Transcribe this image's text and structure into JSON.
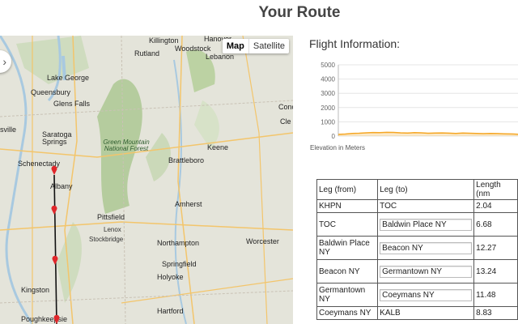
{
  "page": {
    "title": "Your Route"
  },
  "map": {
    "type_controls": {
      "map": "Map",
      "satellite": "Satellite",
      "active": "Map"
    },
    "nav_icon": "chevron-right-icon",
    "cities": [
      {
        "name": "Killington"
      },
      {
        "name": "Hanover"
      },
      {
        "name": "Rutland"
      },
      {
        "name": "Woodstock"
      },
      {
        "name": "Lebanon"
      },
      {
        "name": "Lake George"
      },
      {
        "name": "Queensbury"
      },
      {
        "name": "Glens Falls"
      },
      {
        "name": "Saratoga Springs"
      },
      {
        "name": "Keene"
      },
      {
        "name": "Brattleboro"
      },
      {
        "name": "Schenectady"
      },
      {
        "name": "Albany"
      },
      {
        "name": "Pittsfield"
      },
      {
        "name": "Amherst"
      },
      {
        "name": "Lenox"
      },
      {
        "name": "Stockbridge"
      },
      {
        "name": "Northampton"
      },
      {
        "name": "Worcester"
      },
      {
        "name": "Springfield"
      },
      {
        "name": "Holyoke"
      },
      {
        "name": "Kingston"
      },
      {
        "name": "Hartford"
      },
      {
        "name": "Poughkeepsie"
      },
      {
        "name": "Conc"
      },
      {
        "name": "Cle"
      },
      {
        "name": "sville"
      }
    ],
    "forest_label": "Green Mountain National Forest",
    "route_color": "#111111",
    "marker_color": "#e0272b"
  },
  "flight_info": {
    "heading": "Flight Information:",
    "elevation_label": "Elevation in Meters",
    "chart_data": {
      "type": "area",
      "ylabel": "Elevation in Meters",
      "y_ticks": [
        0,
        1000,
        2000,
        3000,
        4000,
        5000
      ],
      "ylim": [
        0,
        5000
      ],
      "series": [
        {
          "values": [
            120,
            140,
            180,
            200,
            230,
            250,
            240,
            260,
            255,
            230,
            210,
            240,
            230,
            200,
            210,
            220,
            205,
            190,
            210,
            200,
            180,
            170,
            190,
            175,
            160,
            150,
            130
          ]
        }
      ],
      "color": "#f5a623"
    }
  },
  "legs_table": {
    "headers": [
      "Leg (from)",
      "Leg (to)",
      "Length (nm"
    ],
    "rows": [
      {
        "from": "KHPN",
        "to": "TOC",
        "length": "2.04"
      },
      {
        "from": "TOC",
        "to": "Baldwin Place NY",
        "length": "6.68"
      },
      {
        "from": "Baldwin Place NY",
        "to": "Beacon NY",
        "length": "12.27"
      },
      {
        "from": "Beacon NY",
        "to": "Germantown NY",
        "length": "13.24"
      },
      {
        "from": "Germantown NY",
        "to": "Coeymans NY",
        "length": "11.48"
      },
      {
        "from": "Coeymans NY",
        "to": "KALB",
        "length": "8.83"
      }
    ]
  }
}
